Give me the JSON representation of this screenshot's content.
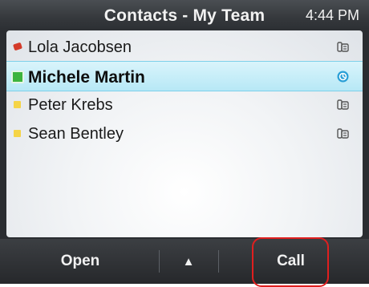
{
  "header": {
    "title": "Contacts - My Team",
    "time": "4:44 PM"
  },
  "contacts": [
    {
      "name": "Lola Jacobsen",
      "status": "busy",
      "icon": "phone-icon"
    },
    {
      "name": "Michele Martin",
      "status": "available",
      "icon": "presence-icon"
    },
    {
      "name": "Peter Krebs",
      "status": "away",
      "icon": "phone-icon"
    },
    {
      "name": "Sean Bentley",
      "status": "away",
      "icon": "phone-icon"
    }
  ],
  "softkeys": {
    "open": "Open",
    "up": "▲",
    "call": "Call"
  },
  "colors": {
    "busy": "#d43b2a",
    "available": "#3db43d",
    "away": "#f5d447",
    "highlight": "#e01f1f"
  }
}
